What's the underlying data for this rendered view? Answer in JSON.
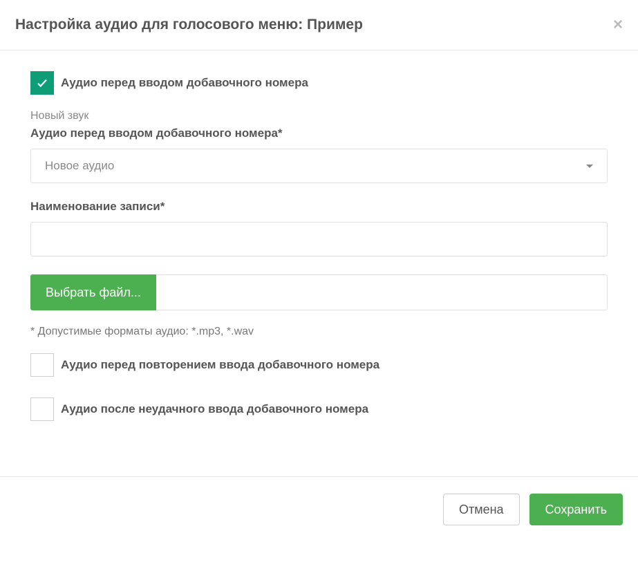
{
  "header": {
    "title": "Настройка аудио для голосового меню: Пример"
  },
  "checkboxes": {
    "before_input": {
      "label": "Аудио перед вводом добавочного номера",
      "checked": true
    },
    "before_repeat": {
      "label": "Аудио перед повторением ввода добавочного номера",
      "checked": false
    },
    "after_fail": {
      "label": "Аудио после неудачного ввода добавочного номера",
      "checked": false
    }
  },
  "section": {
    "new_sound": "Новый звук",
    "audio_label": "Аудио перед вводом добавочного номера*",
    "audio_select_value": "Новое аудио",
    "name_label": "Наименование записи*",
    "name_value": "",
    "file_button": "Выбрать файл...",
    "file_value": "",
    "hint": "* Допустимые форматы аудио: *.mp3, *.wav"
  },
  "footer": {
    "cancel": "Отмена",
    "save": "Сохранить"
  }
}
